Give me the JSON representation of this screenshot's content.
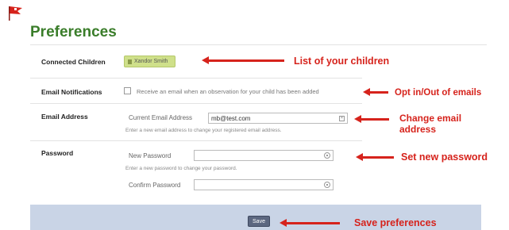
{
  "header": {
    "title": "Preferences",
    "logo_icon": "red-flag-icon"
  },
  "rows": {
    "children": {
      "label": "Connected Children",
      "chip": "Xandor Smith"
    },
    "email_notifications": {
      "label": "Email Notifications",
      "checkbox_text": "Receive an email when an observation for your child has been added",
      "checked": false
    },
    "email_address": {
      "label": "Email Address",
      "field_label": "Current Email Address",
      "value": "mb@test.com",
      "help": "Enter a new email address to change your registered email address."
    },
    "password": {
      "label": "Password",
      "new_label": "New Password",
      "new_value": "",
      "help": "Enter a new password to change your password.",
      "confirm_label": "Confirm Password",
      "confirm_value": ""
    }
  },
  "footer": {
    "save_label": "Save"
  },
  "annotations": {
    "children": "List of your children",
    "email_opt": "Opt in/Out of emails",
    "change_email": "Change email\naddress",
    "set_password": "Set new password",
    "save": "Save preferences"
  },
  "colors": {
    "title_green": "#3a7d2a",
    "annotation_red": "#d6231c",
    "footer_blue": "#c9d4e6",
    "chip_green": "#cfe08a"
  }
}
